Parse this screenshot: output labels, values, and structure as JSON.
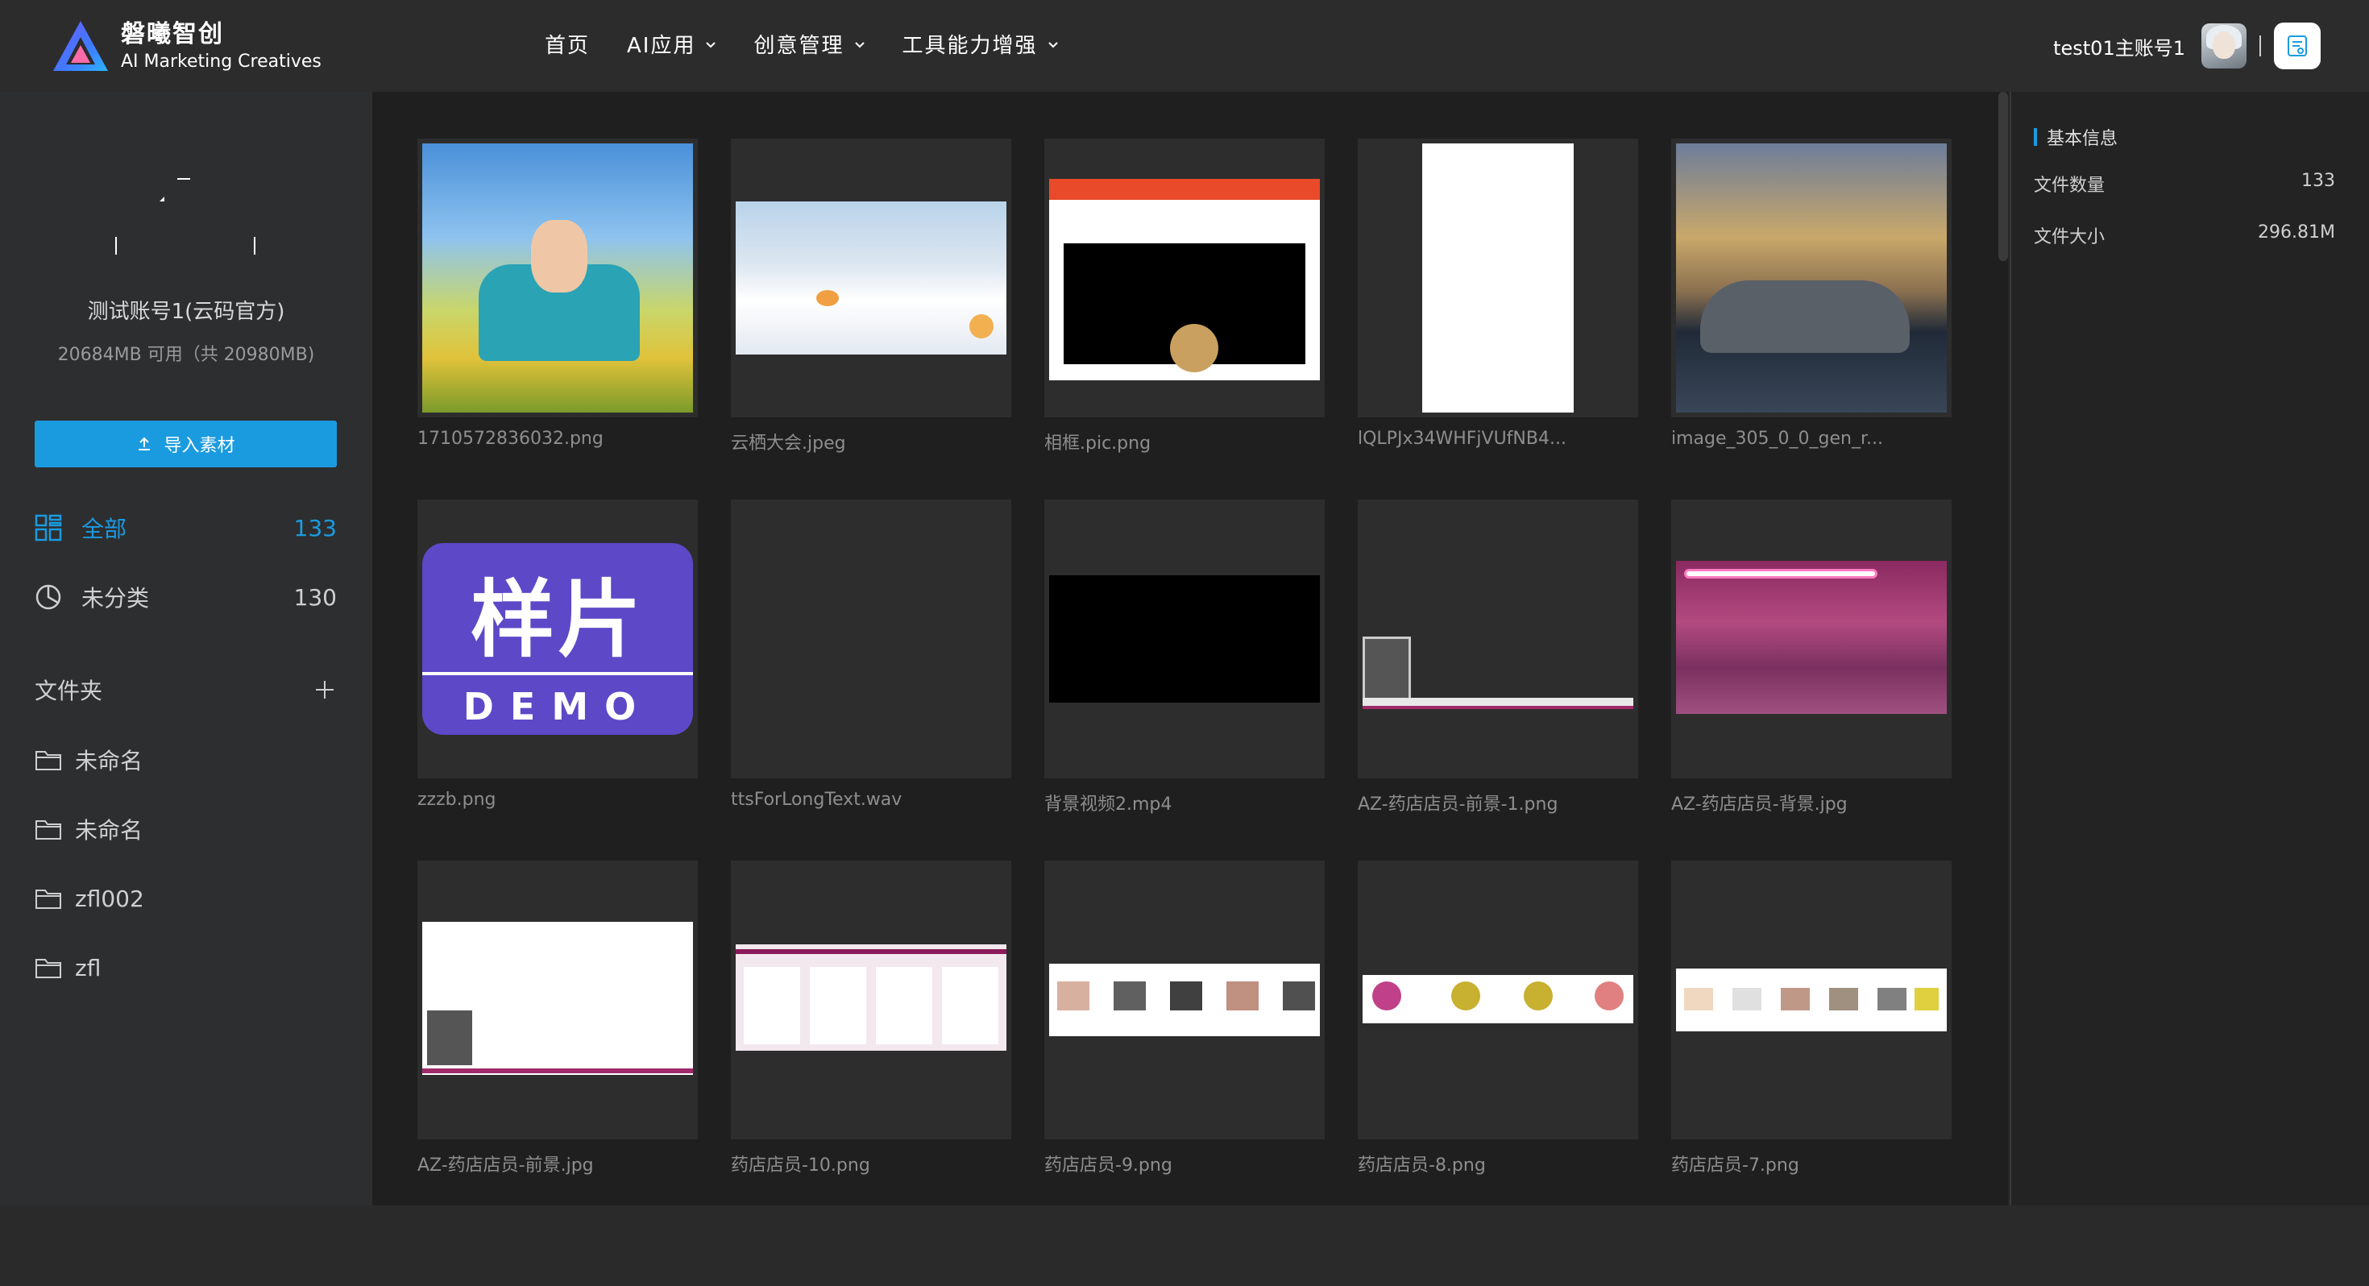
{
  "header": {
    "brand_cn": "磐曦智创",
    "brand_en": "AI Marketing Creatives",
    "nav": [
      {
        "label": "首页",
        "dropdown": false
      },
      {
        "label": "AI应用",
        "dropdown": true
      },
      {
        "label": "创意管理",
        "dropdown": true
      },
      {
        "label": "工具能力增强",
        "dropdown": true
      }
    ],
    "user_name": "test01主账号1"
  },
  "sidebar": {
    "account_name": "测试账号1(云码官方)",
    "storage": "20684MB 可用（共 20980MB)",
    "import_label": "导入素材",
    "filters": [
      {
        "label": "全部",
        "count": "133",
        "icon": "grid-icon",
        "active": true
      },
      {
        "label": "未分类",
        "count": "130",
        "icon": "pie-icon",
        "active": false
      }
    ],
    "folders_label": "文件夹",
    "folders": [
      {
        "label": "未命名"
      },
      {
        "label": "未命名"
      },
      {
        "label": "zfl002"
      },
      {
        "label": "zfl"
      }
    ]
  },
  "files": [
    {
      "name": "1710572836032.png"
    },
    {
      "name": "云栖大会.jpeg"
    },
    {
      "name": "相框.pic.png"
    },
    {
      "name": "lQLPJx34WHFjVUfNB4..."
    },
    {
      "name": "image_305_0_0_gen_r..."
    },
    {
      "name": "zzzb.png",
      "thumb_text": "样片",
      "thumb_sub": "DEMO"
    },
    {
      "name": "ttsForLongText.wav"
    },
    {
      "name": "背景视频2.mp4"
    },
    {
      "name": "AZ-药店店员-前景-1.png"
    },
    {
      "name": "AZ-药店店员-背景.jpg"
    },
    {
      "name": "AZ-药店店员-前景.jpg"
    },
    {
      "name": "药店店员-10.png"
    },
    {
      "name": "药店店员-9.png"
    },
    {
      "name": "药店店员-8.png"
    },
    {
      "name": "药店店员-7.png"
    }
  ],
  "info": {
    "title": "基本信息",
    "rows": [
      {
        "label": "文件数量",
        "value": "133"
      },
      {
        "label": "文件大小",
        "value": "296.81M"
      }
    ]
  },
  "colors": {
    "accent": "#1a9be0",
    "bg_main": "#1f1f1f",
    "bg_sidebar": "#2d2e30"
  }
}
